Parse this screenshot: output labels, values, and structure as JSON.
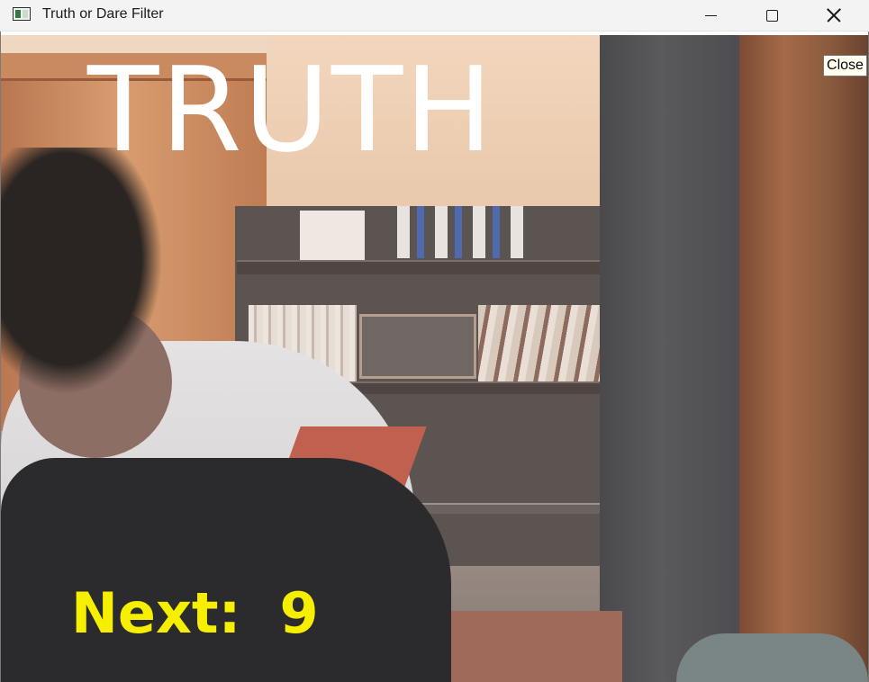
{
  "window": {
    "title": "Truth or Dare Filter",
    "tooltip": "Close"
  },
  "icons": {
    "app": "app-icon",
    "minimize": "minimize-icon",
    "maximize": "maximize-icon",
    "close": "close-icon"
  },
  "overlay": {
    "result": "TRUTH",
    "next_label": "Next:",
    "next_value": "9"
  },
  "colors": {
    "result_text": "#ffffff",
    "next_text": "#f6ef00"
  }
}
